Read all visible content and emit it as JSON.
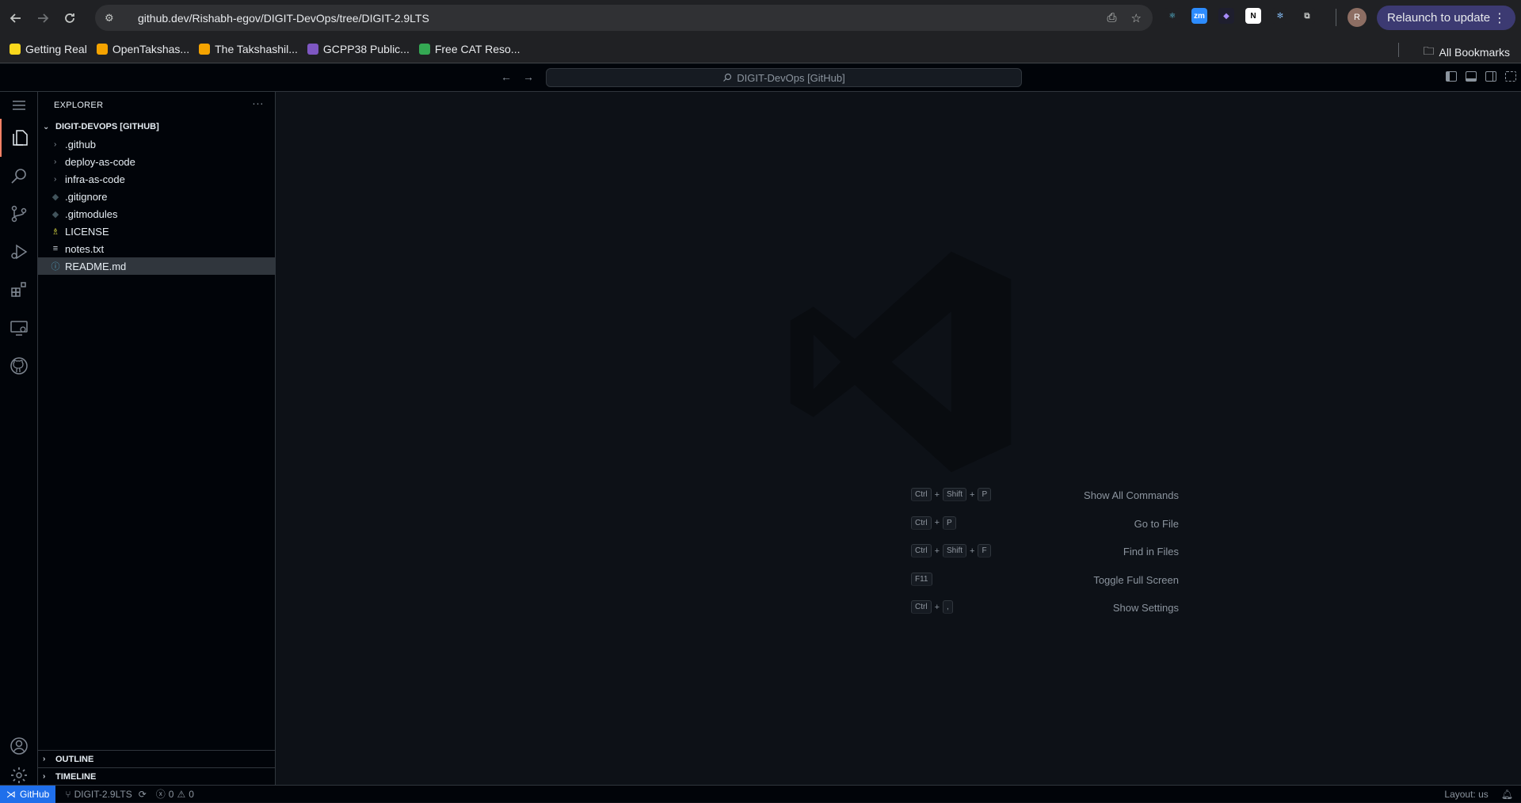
{
  "browser": {
    "url": "github.dev/Rishabh-egov/DIGIT-DevOps/tree/DIGIT-2.9LTS",
    "relaunch_label": "Relaunch to update",
    "avatar_letter": "R",
    "bookmarks": [
      {
        "label": "Getting Real",
        "color": "#f9d71c"
      },
      {
        "label": "OpenTakshas...",
        "color": "#f4a300"
      },
      {
        "label": "The Takshashil...",
        "color": "#f4a300"
      },
      {
        "label": "GCPP38 Public...",
        "color": "#7e57c2"
      },
      {
        "label": "Free CAT Reso...",
        "color": "#34a853"
      }
    ],
    "all_bookmarks_label": "All Bookmarks",
    "extensions": [
      {
        "name": "react-icon",
        "text": "⚛",
        "bg": "#202124",
        "color": "#61dafb"
      },
      {
        "name": "zoom-icon",
        "text": "zm",
        "bg": "#2d8cff",
        "color": "#ffffff"
      },
      {
        "name": "obsidian-icon",
        "text": "◆",
        "bg": "#1e1e2e",
        "color": "#a78bfa"
      },
      {
        "name": "notion-icon",
        "text": "N",
        "bg": "#ffffff",
        "color": "#000000"
      },
      {
        "name": "snowflake-icon",
        "text": "✻",
        "bg": "#202124",
        "color": "#7fb3e8"
      },
      {
        "name": "extensions-puzzle-icon",
        "text": "⧉",
        "bg": "#202124",
        "color": "#c4c7c5"
      }
    ]
  },
  "vscode": {
    "command_center": "DIGIT-DevOps [GitHub]",
    "explorer_title": "EXPLORER",
    "root_folder": "DIGIT-DEVOPS [GITHUB]",
    "tree": [
      {
        "label": ".github",
        "type": "folder",
        "icon": "›",
        "icon_color": "#8b949e"
      },
      {
        "label": "deploy-as-code",
        "type": "folder",
        "icon": "›",
        "icon_color": "#8b949e"
      },
      {
        "label": "infra-as-code",
        "type": "folder",
        "icon": "›",
        "icon_color": "#8b949e"
      },
      {
        "label": ".gitignore",
        "type": "file",
        "icon": "◆",
        "icon_color": "#41535b"
      },
      {
        "label": ".gitmodules",
        "type": "file",
        "icon": "◆",
        "icon_color": "#41535b"
      },
      {
        "label": "LICENSE",
        "type": "file",
        "icon": "♗",
        "icon_color": "#cbcb41"
      },
      {
        "label": "notes.txt",
        "type": "file",
        "icon": "≡",
        "icon_color": "#c9d1d9"
      },
      {
        "label": "README.md",
        "type": "file",
        "icon": "ⓘ",
        "icon_color": "#519aba",
        "selected": true
      }
    ],
    "outline_label": "OUTLINE",
    "timeline_label": "TIMELINE",
    "shortcuts": [
      {
        "label": "Show All Commands",
        "keys": [
          "Ctrl",
          "Shift",
          "P"
        ]
      },
      {
        "label": "Go to File",
        "keys": [
          "Ctrl",
          "P"
        ]
      },
      {
        "label": "Find in Files",
        "keys": [
          "Ctrl",
          "Shift",
          "F"
        ]
      },
      {
        "label": "Toggle Full Screen",
        "keys": [
          "F11"
        ]
      },
      {
        "label": "Show Settings",
        "keys": [
          "Ctrl",
          ","
        ]
      }
    ],
    "status": {
      "remote": "GitHub",
      "branch": "DIGIT-2.9LTS",
      "errors": "0",
      "warnings": "0",
      "layout": "Layout: us"
    },
    "colors": {
      "accent": "#1f6feb",
      "active_border": "#f78166",
      "background": "#0d1117"
    }
  }
}
